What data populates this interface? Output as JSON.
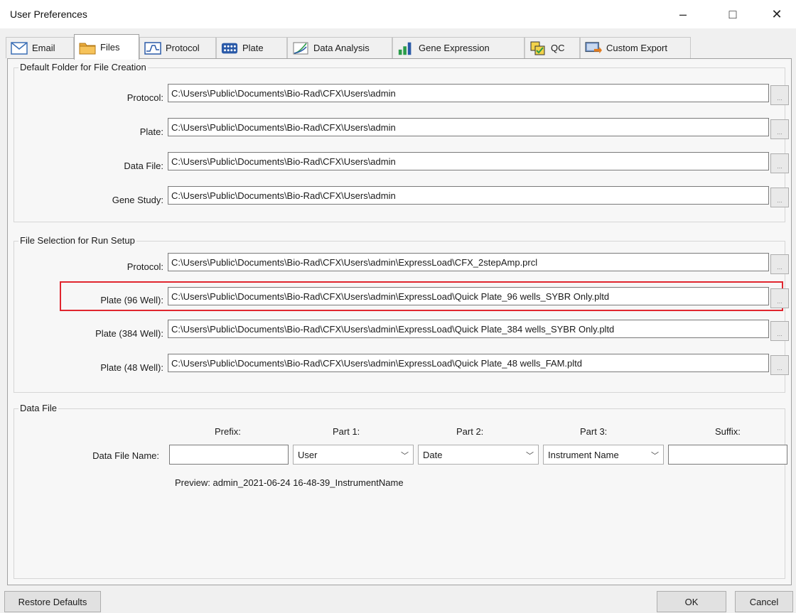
{
  "window": {
    "title": "User Preferences",
    "minimize_glyph": "–",
    "maximize_glyph": "□",
    "close_glyph": "✕"
  },
  "tabs": [
    {
      "label": "Email",
      "icon": "envelope-icon"
    },
    {
      "label": "Files",
      "icon": "folder-icon"
    },
    {
      "label": "Protocol",
      "icon": "protocol-graph-icon"
    },
    {
      "label": "Plate",
      "icon": "plate-grid-icon"
    },
    {
      "label": "Data Analysis",
      "icon": "data-analysis-icon"
    },
    {
      "label": "Gene Expression",
      "icon": "bar-chart-icon"
    },
    {
      "label": "QC",
      "icon": "qc-icon"
    },
    {
      "label": "Custom Export",
      "icon": "export-icon"
    }
  ],
  "active_tab": "Files",
  "default_folder": {
    "title": "Default Folder for File Creation",
    "rows": [
      {
        "label": "Protocol:",
        "value": "C:\\Users\\Public\\Documents\\Bio-Rad\\CFX\\Users\\admin"
      },
      {
        "label": "Plate:",
        "value": "C:\\Users\\Public\\Documents\\Bio-Rad\\CFX\\Users\\admin"
      },
      {
        "label": "Data File:",
        "value": "C:\\Users\\Public\\Documents\\Bio-Rad\\CFX\\Users\\admin"
      },
      {
        "label": "Gene Study:",
        "value": "C:\\Users\\Public\\Documents\\Bio-Rad\\CFX\\Users\\admin"
      }
    ]
  },
  "run_setup": {
    "title": "File Selection for Run Setup",
    "rows": [
      {
        "label": "Protocol:",
        "value": "C:\\Users\\Public\\Documents\\Bio-Rad\\CFX\\Users\\admin\\ExpressLoad\\CFX_2stepAmp.prcl"
      },
      {
        "label": "Plate (96 Well):",
        "value": "C:\\Users\\Public\\Documents\\Bio-Rad\\CFX\\Users\\admin\\ExpressLoad\\Quick Plate_96 wells_SYBR Only.pltd"
      },
      {
        "label": "Plate (384 Well):",
        "value": "C:\\Users\\Public\\Documents\\Bio-Rad\\CFX\\Users\\admin\\ExpressLoad\\Quick Plate_384 wells_SYBR Only.pltd"
      },
      {
        "label": "Plate (48 Well):",
        "value": "C:\\Users\\Public\\Documents\\Bio-Rad\\CFX\\Users\\admin\\ExpressLoad\\Quick Plate_48 wells_FAM.pltd"
      }
    ]
  },
  "data_file": {
    "title": "Data File",
    "name_label": "Data File Name:",
    "headers": {
      "prefix": "Prefix:",
      "part1": "Part 1:",
      "part2": "Part 2:",
      "part3": "Part 3:",
      "suffix": "Suffix:"
    },
    "prefix_value": "",
    "part1_value": "User",
    "part2_value": "Date",
    "part3_value": "Instrument Name",
    "suffix_value": "",
    "preview": "Preview: admin_2021-06-24 16-48-39_InstrumentName"
  },
  "buttons": {
    "restore": "Restore Defaults",
    "ok": "OK",
    "cancel": "Cancel",
    "browse": "..."
  },
  "colors": {
    "highlight": "#e0262f"
  }
}
